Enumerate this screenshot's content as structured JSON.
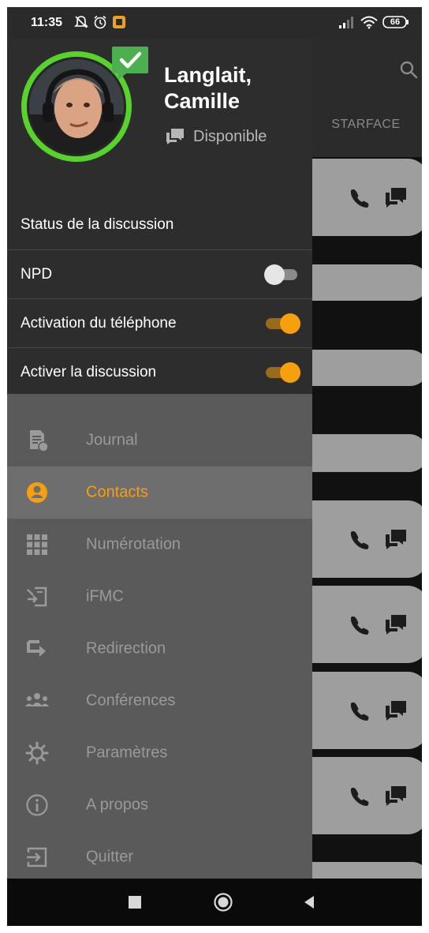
{
  "status_bar": {
    "time": "11:35",
    "battery": "66",
    "icons": [
      "notifications-off-icon",
      "alarm-icon",
      "app-notification-icon",
      "signal-icon",
      "wifi-icon",
      "battery-icon"
    ]
  },
  "background_app": {
    "tab_label": "STARFACE",
    "icons": [
      "search-icon",
      "call-icon",
      "chat-icon"
    ]
  },
  "drawer": {
    "user": {
      "name": "Langlait, Camille",
      "presence": "Disponible",
      "avatar_ring_color": "#57d32c",
      "badge_color": "#4caf50"
    },
    "settings": {
      "chat_status_label": "Status de la discussion",
      "dnd": {
        "label": "NPD",
        "on": false
      },
      "phone_activation": {
        "label": "Activation du téléphone",
        "on": true
      },
      "chat_activation": {
        "label": "Activer la discussion",
        "on": true
      }
    },
    "nav_items": [
      {
        "label": "Journal",
        "icon": "journal-icon",
        "active": false
      },
      {
        "label": "Contacts",
        "icon": "contacts-icon",
        "active": true
      },
      {
        "label": "Numérotation",
        "icon": "dialpad-icon",
        "active": false
      },
      {
        "label": "iFMC",
        "icon": "ifmc-icon",
        "active": false
      },
      {
        "label": "Redirection",
        "icon": "redirect-icon",
        "active": false
      },
      {
        "label": "Conférences",
        "icon": "conference-icon",
        "active": false
      },
      {
        "label": "Paramètres",
        "icon": "settings-icon",
        "active": false
      },
      {
        "label": "A propos",
        "icon": "info-icon",
        "active": false
      },
      {
        "label": "Quitter",
        "icon": "logout-icon",
        "active": false
      }
    ]
  },
  "colors": {
    "accent": "#f5a00c",
    "presence_green": "#57d32c",
    "drawer_head_bg": "#2d2d2d",
    "drawer_body_bg": "#5a5a5a"
  },
  "system_nav": [
    "recent-apps-button",
    "home-button",
    "back-button"
  ]
}
